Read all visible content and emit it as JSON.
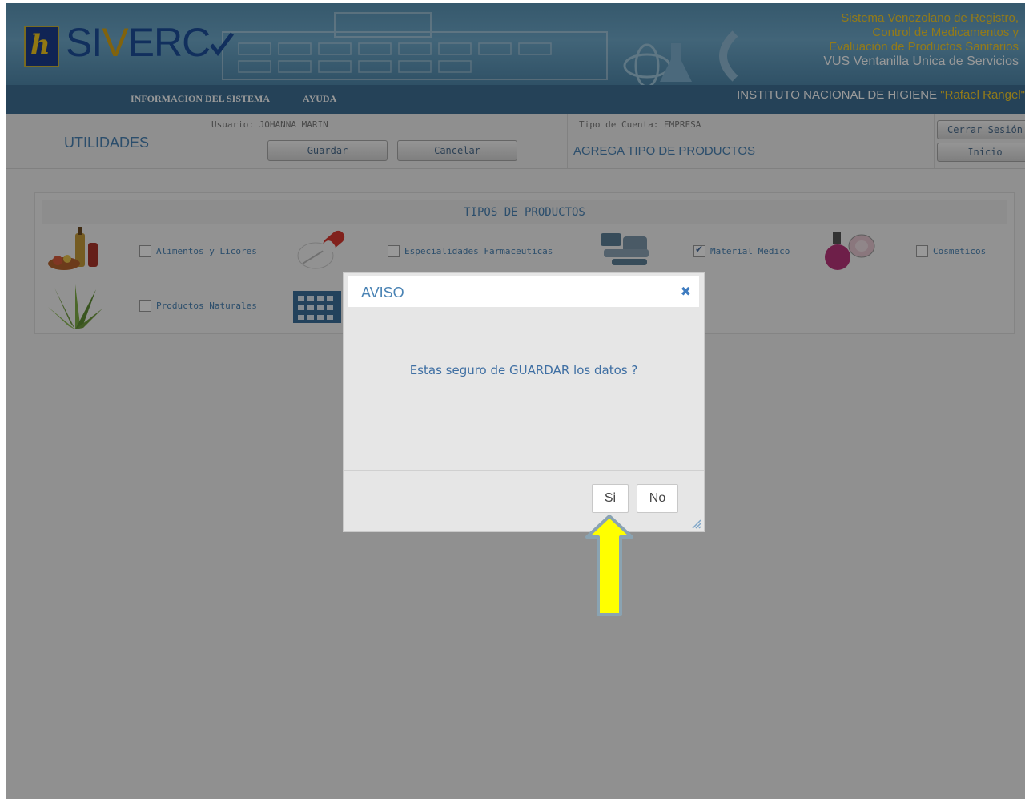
{
  "header": {
    "logo_text_pre": "SI",
    "logo_text_v": "V",
    "logo_text_post": "ERC",
    "system_title_lines": [
      "Sistema Venezolano de Registro,",
      "Control de Medicamentos y",
      "Evaluación de Productos Sanitarios"
    ],
    "system_subtitle": "VUS Ventanilla Unica de Servicios",
    "nav_items": [
      "INFORMACION DEL SISTEMA",
      "AYUDA"
    ],
    "institute_prefix": "INSTITUTO NACIONAL DE HIGIENE ",
    "institute_highlight": "\"Rafael Rangel\""
  },
  "toolbar": {
    "module": "UTILIDADES",
    "user": "Usuario: JOHANNA MARIN",
    "account_type": "Tipo de Cuenta: EMPRESA",
    "save_label": "Guardar",
    "cancel_label": "Cancelar",
    "action_title": "AGREGA TIPO DE PRODUCTOS",
    "logout_label": "Cerrar Sesión",
    "home_label": "Inicio"
  },
  "panel": {
    "title": "TIPOS DE PRODUCTOS",
    "products": [
      {
        "label": "Alimentos y Licores",
        "checked": false,
        "icon": "bottles-food-icon"
      },
      {
        "label": "Especialidades Farmaceuticas",
        "checked": false,
        "icon": "pills-icon"
      },
      {
        "label": "Material Medico",
        "checked": true,
        "icon": "medical-equipment-icon"
      },
      {
        "label": "Cosmeticos",
        "checked": false,
        "icon": "cosmetics-icon"
      },
      {
        "label": "Productos Naturales",
        "checked": false,
        "icon": "aloe-plant-icon"
      }
    ]
  },
  "dialog": {
    "title": "AVISO",
    "message": "Estas seguro de GUARDAR los datos ?",
    "yes_label": "Si",
    "no_label": "No"
  },
  "colors": {
    "accent": "#4a83b4",
    "navbar": "#3e6f93",
    "highlight_arrow": "#ffff00"
  }
}
